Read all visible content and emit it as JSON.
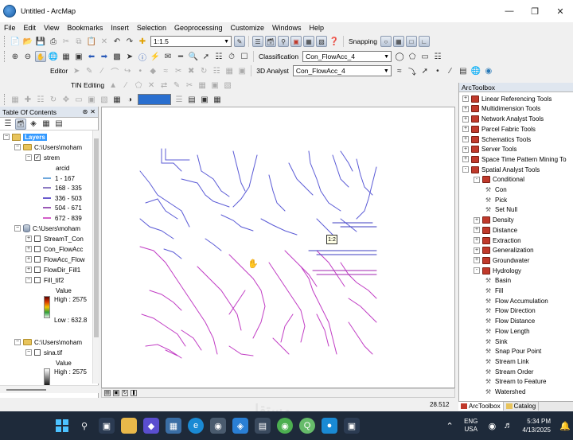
{
  "window": {
    "title": "Untitled - ArcMap"
  },
  "menu": [
    "File",
    "Edit",
    "View",
    "Bookmarks",
    "Insert",
    "Selection",
    "Geoprocessing",
    "Customize",
    "Windows",
    "Help"
  ],
  "toolbar1": {
    "scale": "1:1.5",
    "snapping_label": "Snapping"
  },
  "toolbar2": {
    "classification_label": "Classification",
    "classification_layer": "Con_FlowAcc_4"
  },
  "toolbar3": {
    "editor_label": "Editor",
    "analyst_label": "3D Analyst",
    "analyst_layer": "Con_FlowAcc_4"
  },
  "toolbar4": {
    "tin_label": "TIN Editing"
  },
  "toc": {
    "title": "Table Of Contents",
    "layers_label": "Layers",
    "group1": {
      "path": "C:\\Users\\moham",
      "layer": "strem",
      "field": "arcid",
      "classes": [
        {
          "label": "1 - 167",
          "color": "#6fa8dc"
        },
        {
          "label": "168 - 335",
          "color": "#8e7cc3"
        },
        {
          "label": "336 - 503",
          "color": "#6a5acd"
        },
        {
          "label": "504 - 671",
          "color": "#9b59b6"
        },
        {
          "label": "672 - 839",
          "color": "#d35fc9"
        }
      ]
    },
    "group2": {
      "path": "C:\\Users\\moham",
      "layers": [
        "StreamT_Con",
        "Con_FlowAcc",
        "FlowAcc_Flow",
        "FlowDir_Fill1",
        "Fill_tif2"
      ],
      "value_label": "Value",
      "high": "High : 2575",
      "low": "Low : 632.8"
    },
    "group3": {
      "path": "C:\\Users\\moham",
      "layer": "sina.tif",
      "value_label": "Value",
      "high": "High : 2575"
    }
  },
  "map": {
    "scale_tag": "1:2"
  },
  "status": {
    "coordinates": "28.512"
  },
  "arctoolbox": {
    "title": "ArcToolbox",
    "items": [
      {
        "label": "Linear Referencing Tools",
        "kind": "box",
        "exp": "+",
        "level": 0
      },
      {
        "label": "Multidimension Tools",
        "kind": "box",
        "exp": "+",
        "level": 0
      },
      {
        "label": "Network Analyst Tools",
        "kind": "box",
        "exp": "+",
        "level": 0
      },
      {
        "label": "Parcel Fabric Tools",
        "kind": "box",
        "exp": "+",
        "level": 0
      },
      {
        "label": "Schematics Tools",
        "kind": "box",
        "exp": "+",
        "level": 0
      },
      {
        "label": "Server Tools",
        "kind": "box",
        "exp": "+",
        "level": 0
      },
      {
        "label": "Space Time Pattern Mining To",
        "kind": "box",
        "exp": "+",
        "level": 0
      },
      {
        "label": "Spatial Analyst Tools",
        "kind": "box",
        "exp": "-",
        "level": 0
      },
      {
        "label": "Conditional",
        "kind": "box",
        "exp": "-",
        "level": 1
      },
      {
        "label": "Con",
        "kind": "tool",
        "exp": "",
        "level": 2
      },
      {
        "label": "Pick",
        "kind": "tool",
        "exp": "",
        "level": 2
      },
      {
        "label": "Set Null",
        "kind": "tool",
        "exp": "",
        "level": 2
      },
      {
        "label": "Density",
        "kind": "box",
        "exp": "+",
        "level": 1
      },
      {
        "label": "Distance",
        "kind": "box",
        "exp": "+",
        "level": 1
      },
      {
        "label": "Extraction",
        "kind": "box",
        "exp": "+",
        "level": 1
      },
      {
        "label": "Generalization",
        "kind": "box",
        "exp": "+",
        "level": 1
      },
      {
        "label": "Groundwater",
        "kind": "box",
        "exp": "+",
        "level": 1
      },
      {
        "label": "Hydrology",
        "kind": "box",
        "exp": "-",
        "level": 1
      },
      {
        "label": "Basin",
        "kind": "tool",
        "exp": "",
        "level": 2
      },
      {
        "label": "Fill",
        "kind": "tool",
        "exp": "",
        "level": 2
      },
      {
        "label": "Flow Accumulation",
        "kind": "tool",
        "exp": "",
        "level": 2
      },
      {
        "label": "Flow Direction",
        "kind": "tool",
        "exp": "",
        "level": 2
      },
      {
        "label": "Flow Distance",
        "kind": "tool",
        "exp": "",
        "level": 2
      },
      {
        "label": "Flow Length",
        "kind": "tool",
        "exp": "",
        "level": 2
      },
      {
        "label": "Sink",
        "kind": "tool",
        "exp": "",
        "level": 2
      },
      {
        "label": "Snap Pour Point",
        "kind": "tool",
        "exp": "",
        "level": 2
      },
      {
        "label": "Stream Link",
        "kind": "tool",
        "exp": "",
        "level": 2
      },
      {
        "label": "Stream Order",
        "kind": "tool",
        "exp": "",
        "level": 2
      },
      {
        "label": "Stream to Feature",
        "kind": "tool",
        "exp": "",
        "level": 2
      },
      {
        "label": "Watershed",
        "kind": "tool",
        "exp": "",
        "level": 2
      }
    ],
    "tabs": [
      "ArcToolbox",
      "Catalog"
    ]
  },
  "taskbar": {
    "lang1": "ENG",
    "lang2": "USA",
    "time": "5:34 PM",
    "date": "4/13/2025"
  },
  "watermark": "مستقل"
}
